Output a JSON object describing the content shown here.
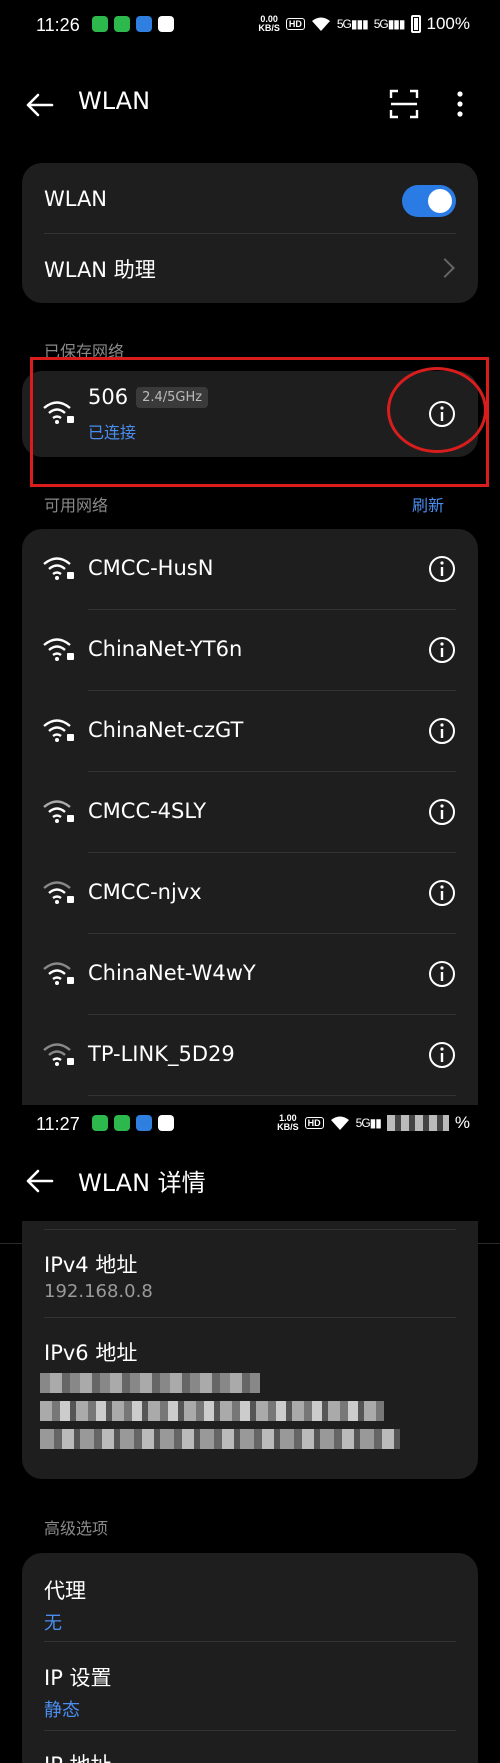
{
  "screen1": {
    "status": {
      "time": "11:26",
      "speed_top": "0.00",
      "speed_unit": "KB/S",
      "hd": "HD",
      "net1": "5G",
      "net2": "5G",
      "battery": "100%"
    },
    "appbar": {
      "title": "WLAN"
    },
    "wlan_card": {
      "wlan_label": "WLAN",
      "assistant_label": "WLAN 助理"
    },
    "saved_section": {
      "label": "已保存网络"
    },
    "saved_network": {
      "name": "506",
      "band": "2.4/5GHz",
      "status": "已连接"
    },
    "available_section": {
      "label": "可用网络",
      "refresh": "刷新"
    },
    "available_networks": [
      {
        "name": "CMCC-HusN"
      },
      {
        "name": "ChinaNet-YT6n"
      },
      {
        "name": "ChinaNet-czGT"
      },
      {
        "name": "CMCC-4SLY"
      },
      {
        "name": "CMCC-njvx"
      },
      {
        "name": "ChinaNet-W4wY"
      },
      {
        "name": "TP-LINK_5D29"
      }
    ]
  },
  "screen2": {
    "status": {
      "time": "11:27",
      "speed_top": "1.00",
      "speed_unit": "KB/S",
      "hd": "HD",
      "net1": "5G",
      "battery": "%"
    },
    "appbar": {
      "title": "WLAN 详情"
    },
    "details": {
      "ipv4_label": "IPv4 地址",
      "ipv4_value": "192.168.0.8",
      "ipv6_label": "IPv6 地址"
    },
    "advanced_section": {
      "label": "高级选项"
    },
    "advanced": {
      "proxy_label": "代理",
      "proxy_value": "无",
      "ip_settings_label": "IP 设置",
      "ip_settings_value": "静态",
      "ip_address_label": "IP 地址"
    }
  },
  "colors": {
    "accent": "#4a8ef0",
    "toggle": "#2b7be4",
    "card": "#1e1e1e",
    "highlight": "#d91d1d"
  }
}
